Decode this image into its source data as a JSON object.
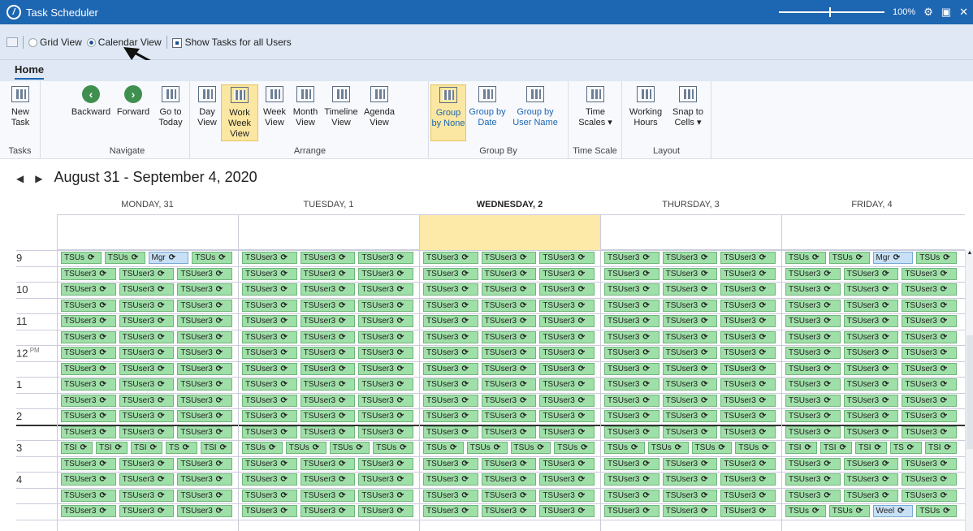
{
  "window": {
    "title": "Task Scheduler",
    "zoom": "100%"
  },
  "toolbar": {
    "grid_view": "Grid View",
    "calendar_view": "Calendar View",
    "show_all_users": "Show Tasks for all Users"
  },
  "tab": {
    "home": "Home"
  },
  "ribbon": {
    "tasks": {
      "label": "Tasks",
      "new_task": "New Task"
    },
    "navigate": {
      "label": "Navigate",
      "backward": "Backward",
      "forward": "Forward",
      "goto_today": "Go to Today"
    },
    "arrange": {
      "label": "Arrange",
      "day": "Day View",
      "work_week": "Work Week View",
      "week": "Week View",
      "month": "Month View",
      "timeline": "Timeline View",
      "agenda": "Agenda View"
    },
    "groupby": {
      "label": "Group By",
      "none": "Group by None",
      "date": "Group by Date",
      "user": "Group by User Name"
    },
    "timescale": {
      "label": "Time Scale",
      "scales": "Time Scales ▾"
    },
    "layout": {
      "label": "Layout",
      "working_hours": "Working Hours",
      "snap": "Snap to Cells ▾"
    }
  },
  "calendar": {
    "range": "August 31 - September 4, 2020",
    "days": [
      "MONDAY, 31",
      "TUESDAY, 1",
      "WEDNESDAY, 2",
      "THURSDAY, 3",
      "FRIDAY, 4"
    ],
    "hours": [
      "9",
      "10",
      "11",
      "12",
      "1",
      "2",
      "3",
      "4"
    ],
    "pm": "PM"
  }
}
